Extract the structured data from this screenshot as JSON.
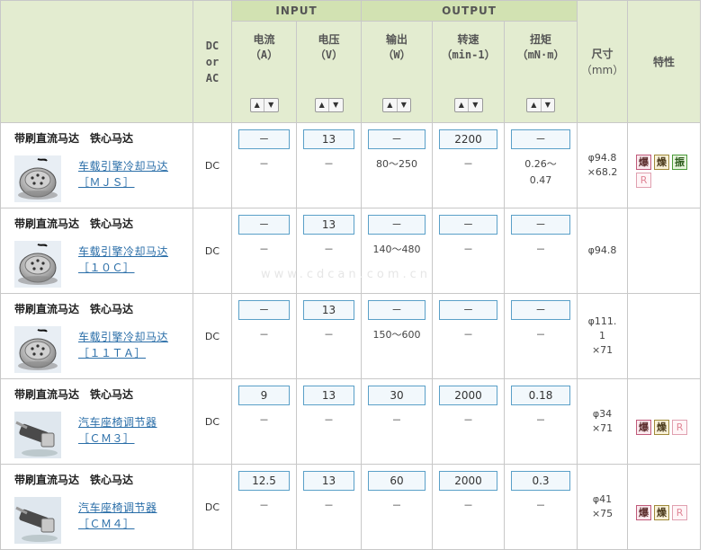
{
  "header": {
    "input_group": "INPUT",
    "output_group": "OUTPUT",
    "dc_or_ac": [
      "DC",
      "or",
      "AC"
    ],
    "current": [
      "电流",
      "（A）"
    ],
    "voltage": [
      "电压",
      "（V）"
    ],
    "power": [
      "输出",
      "（W）"
    ],
    "speed": [
      "转速",
      "（min-1）"
    ],
    "torque": [
      "扭矩",
      "（mN·m）"
    ],
    "size": [
      "尺寸",
      "（mm）"
    ],
    "features": "特性",
    "sort_up": "▲",
    "sort_down": "▼"
  },
  "rows": [
    {
      "title": "带刷直流马达　铁心马达",
      "link": [
        "车载引擎冷却马达",
        "［ＭＪＳ］"
      ],
      "dc": "DC",
      "current": [
        "－",
        "－"
      ],
      "voltage": [
        "13",
        "－"
      ],
      "power": [
        "－",
        "80～250"
      ],
      "speed": [
        "2200",
        "－"
      ],
      "torque": [
        "－",
        "0.26～",
        "0.47"
      ],
      "size": [
        "φ94.8",
        "×68.2"
      ],
      "badges": [
        "爆",
        "燥",
        "振",
        "R"
      ]
    },
    {
      "title": "带刷直流马达　铁心马达",
      "link": [
        "车载引擎冷却马达",
        "［１０Ｃ］"
      ],
      "dc": "DC",
      "current": [
        "－",
        "－"
      ],
      "voltage": [
        "13",
        "－"
      ],
      "power": [
        "－",
        "140～480"
      ],
      "speed": [
        "－",
        "－"
      ],
      "torque": [
        "－",
        "－"
      ],
      "size": [
        "φ94.8"
      ],
      "badges": []
    },
    {
      "title": "带刷直流马达　铁心马达",
      "link": [
        "车载引擎冷却马达",
        "［１１ＴＡ］"
      ],
      "dc": "DC",
      "current": [
        "－",
        "－"
      ],
      "voltage": [
        "13",
        "－"
      ],
      "power": [
        "－",
        "150～600"
      ],
      "speed": [
        "－",
        "－"
      ],
      "torque": [
        "－",
        "－"
      ],
      "size": [
        "φ111.",
        "1",
        "×71"
      ],
      "badges": []
    },
    {
      "title": "带刷直流马达　铁心马达",
      "link": [
        "汽车座椅调节器",
        "［ＣＭ３］"
      ],
      "dc": "DC",
      "current": [
        "9",
        "－"
      ],
      "voltage": [
        "13",
        "－"
      ],
      "power": [
        "30",
        "－"
      ],
      "speed": [
        "2000",
        "－"
      ],
      "torque": [
        "0.18",
        "－"
      ],
      "size": [
        "φ34",
        "×71"
      ],
      "badges": [
        "爆",
        "燥",
        "R"
      ]
    },
    {
      "title": "带刷直流马达　铁心马达",
      "link": [
        "汽车座椅调节器",
        "［ＣＭ４］"
      ],
      "dc": "DC",
      "current": [
        "12.5",
        "－"
      ],
      "voltage": [
        "13",
        "－"
      ],
      "power": [
        "60",
        "－"
      ],
      "speed": [
        "2000",
        "－"
      ],
      "torque": [
        "0.3",
        "－"
      ],
      "size": [
        "φ41",
        "×75"
      ],
      "badges": [
        "爆",
        "燥",
        "R"
      ]
    }
  ],
  "colors": {
    "header_bg": "#e3ecd0",
    "group_bg": "#d2e2b2",
    "link": "#2a6ea8",
    "value_border": "#5aa0c8"
  }
}
